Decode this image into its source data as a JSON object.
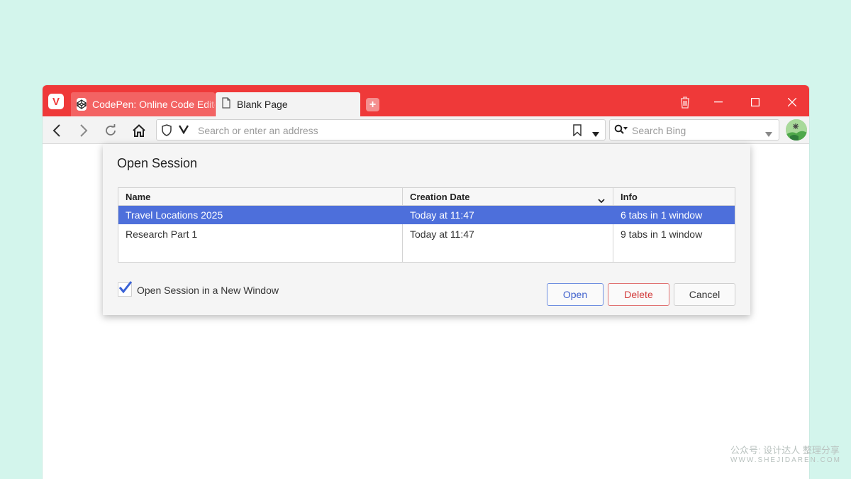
{
  "browser": {
    "tabs": [
      {
        "title": "CodePen: Online Code Editor"
      },
      {
        "title": "Blank Page"
      }
    ],
    "address_placeholder": "Search or enter an address",
    "search_placeholder": "Search Bing",
    "accent_color": "#ef3939"
  },
  "dialog": {
    "title": "Open Session",
    "columns": [
      "Name",
      "Creation Date",
      "Info"
    ],
    "rows": [
      {
        "name": "Travel Locations 2025",
        "date": "Today at 11:47",
        "info": "6 tabs in 1 window",
        "selected": true
      },
      {
        "name": "Research Part 1",
        "date": "Today at 11:47",
        "info": "9 tabs in 1 window",
        "selected": false
      }
    ],
    "checkbox_label": "Open Session in a New Window",
    "checkbox_checked": true,
    "buttons": {
      "open": "Open",
      "delete": "Delete",
      "cancel": "Cancel"
    },
    "selection_color": "#4d6fdb"
  },
  "watermark": {
    "text": "公众号: 设计达人 整理分享",
    "url": "WWW.SHEJIDAREN.COM"
  }
}
